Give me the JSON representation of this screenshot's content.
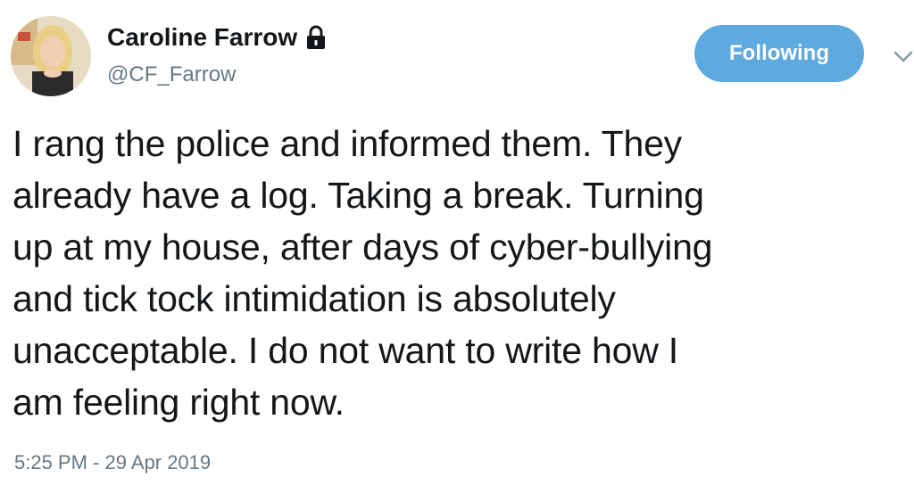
{
  "user": {
    "display_name": "Caroline Farrow",
    "handle": "@CF_Farrow",
    "protected_icon": "lock-icon",
    "avatar_icon": "avatar-photo"
  },
  "actions": {
    "follow_label": "Following",
    "menu_icon": "chevron-down-icon"
  },
  "tweet": {
    "text": "I rang the police and informed them. They\nalready have a log. Taking a break. Turning\nup at my house, after days of cyber-bullying\nand tick tock intimidation is absolutely\nunacceptable. I do not want to write how I\nam feeling right now.",
    "timestamp": "5:25 PM - 29 Apr 2019"
  },
  "colors": {
    "follow_button": "#5ea9dd",
    "secondary_text": "#657786",
    "primary_text": "#14171a"
  }
}
